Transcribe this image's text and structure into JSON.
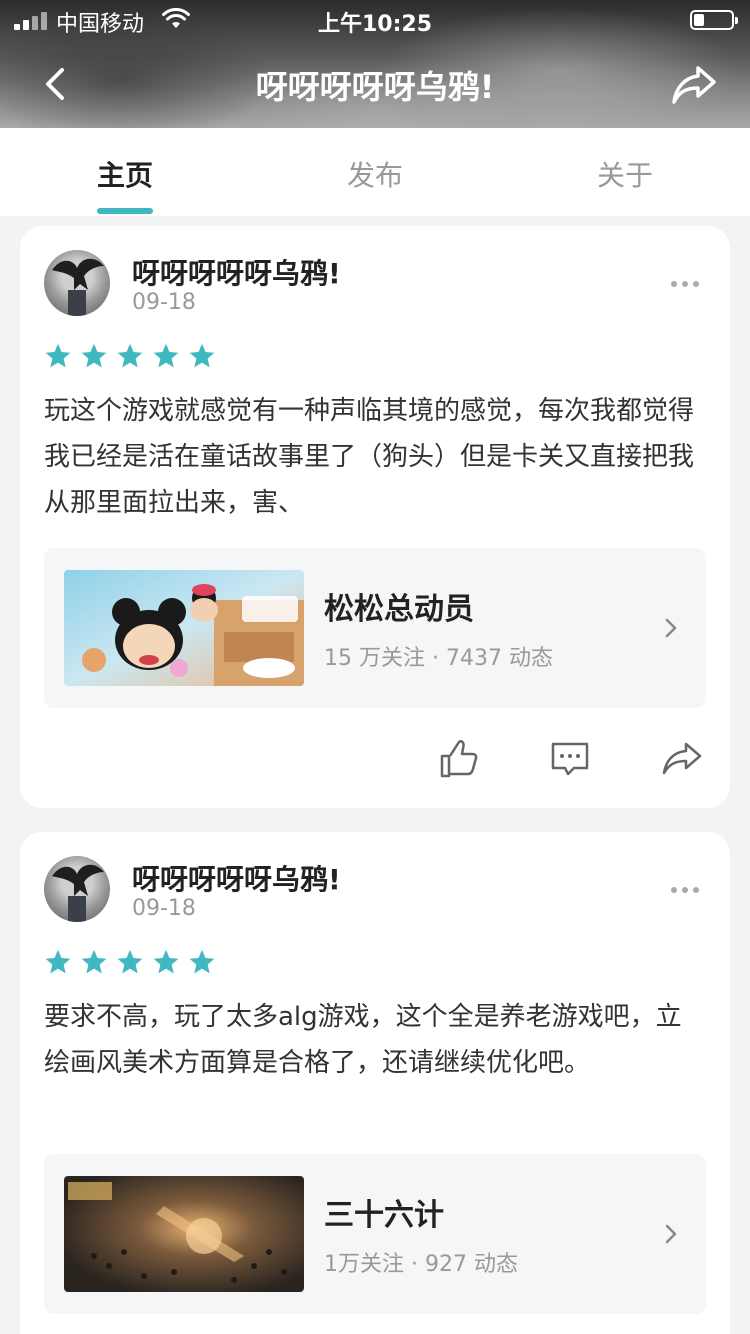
{
  "status_bar": {
    "carrier": "中国移动",
    "time": "上午10:25"
  },
  "nav": {
    "title": "呀呀呀呀呀乌鸦!",
    "back_icon": "chevron-left-icon",
    "share_icon": "share-arrow-icon"
  },
  "tabs": [
    {
      "label": "主页",
      "active": true
    },
    {
      "label": "发布",
      "active": false
    },
    {
      "label": "关于",
      "active": false
    }
  ],
  "accent_color": "#3fb8c2",
  "posts": [
    {
      "author": "呀呀呀呀呀乌鸦!",
      "date": "09-18",
      "rating": 5,
      "text": "玩这个游戏就感觉有一种声临其境的感觉，每次我都觉得我已经是活在童话故事里了（狗头）但是卡关又直接把我从那里面拉出来，害、",
      "game": {
        "name": "松松总动员",
        "meta": "15 万关注 · 7437 动态"
      }
    },
    {
      "author": "呀呀呀呀呀乌鸦!",
      "date": "09-18",
      "rating": 5,
      "text": "要求不高，玩了太多alg游戏，这个全是养老游戏吧，立绘画风美术方面算是合格了，还请继续优化吧。",
      "game": {
        "name": "三十六计",
        "meta": "1万关注 · 927 动态"
      }
    }
  ]
}
